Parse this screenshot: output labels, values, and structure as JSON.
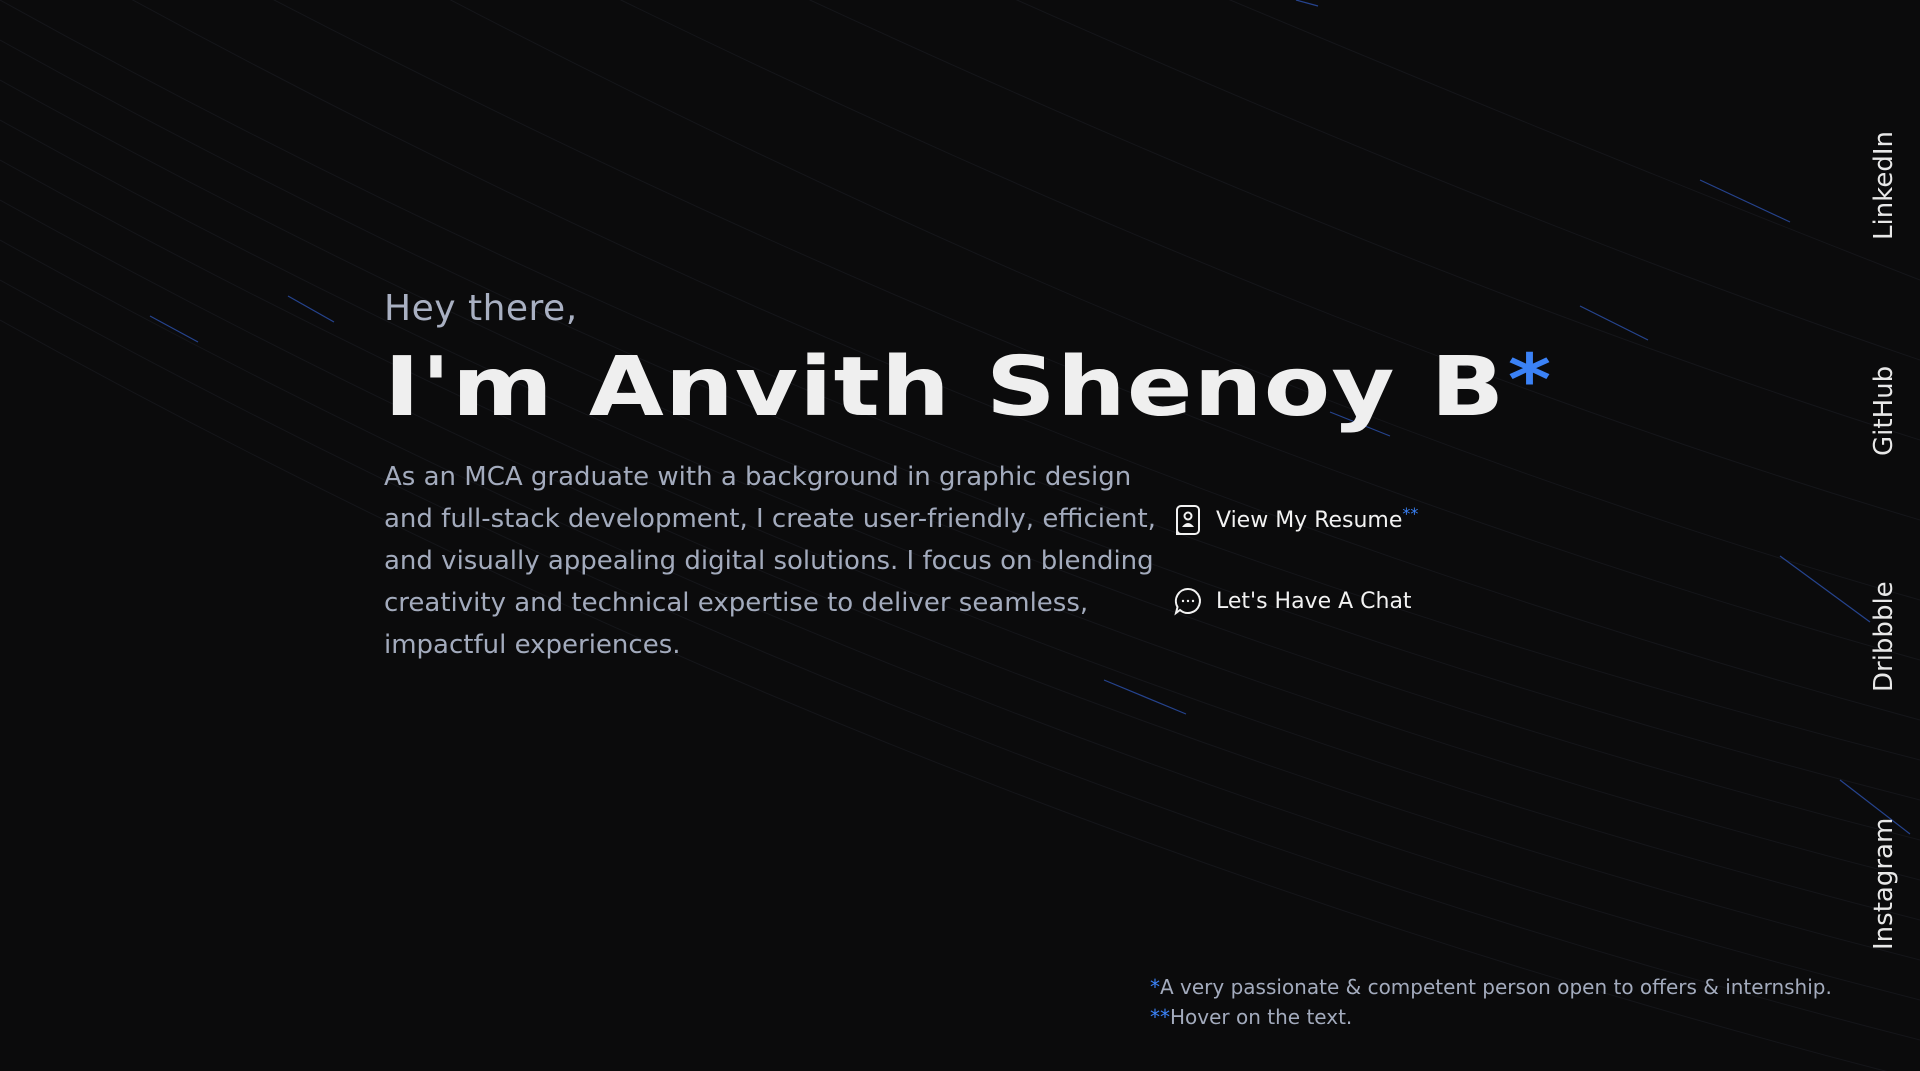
{
  "hero": {
    "greeting": "Hey there,",
    "name": "I'm Anvith Shenoy B",
    "name_mark": "*",
    "bio": "As an MCA graduate with a background in graphic design and full-stack development, I create user-friendly, efficient, and visually appealing digital solutions. I focus on blending creativity and technical expertise to deliver seamless, impactful experiences."
  },
  "actions": [
    {
      "label": "View My Resume",
      "mark": "**",
      "icon": "resume-icon"
    },
    {
      "label": "Let's Have A Chat",
      "mark": "",
      "icon": "chat-icon"
    }
  ],
  "socials": [
    {
      "label": "LinkedIn"
    },
    {
      "label": "GitHub"
    },
    {
      "label": "Dribbble"
    },
    {
      "label": "Instagram"
    }
  ],
  "footnotes": [
    {
      "mark": "*",
      "text": "A very passionate & competent person open to offers & internship."
    },
    {
      "mark": "**",
      "text": "Hover on the text."
    }
  ],
  "colors": {
    "background": "#0b0b0c",
    "accent": "#3b82f6",
    "heading": "#efefef",
    "muted": "#a3abbd"
  }
}
